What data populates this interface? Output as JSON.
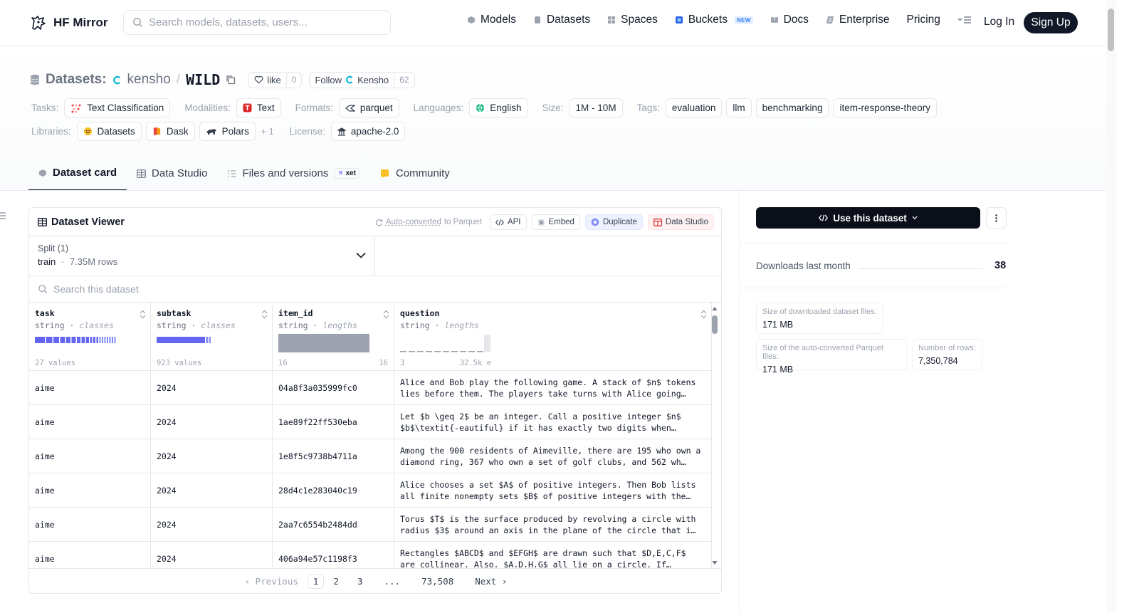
{
  "colors": {
    "brand_dark": "#111827",
    "accent_indigo": "#6366f1",
    "accent_red": "#dc2626",
    "bar_gray": "#9ca3af"
  },
  "nav": {
    "brand": "HF Mirror",
    "search_placeholder": "Search models, datasets, users...",
    "links": [
      {
        "label": "Models",
        "icon": "models-icon"
      },
      {
        "label": "Datasets",
        "icon": "datasets-icon"
      },
      {
        "label": "Spaces",
        "icon": "spaces-icon"
      },
      {
        "label": "Buckets",
        "icon": "buckets-icon",
        "badge": "NEW"
      },
      {
        "label": "Docs",
        "icon": "docs-icon"
      },
      {
        "label": "Enterprise",
        "icon": "enterprise-icon"
      },
      {
        "label": "Pricing"
      }
    ],
    "login": "Log In",
    "signup": "Sign Up"
  },
  "header": {
    "section": "Datasets:",
    "owner": "kensho",
    "slash": "/",
    "name": "WILD",
    "like_label": "like",
    "like_count": "0",
    "follow_label": "Follow",
    "follow_org": "Kensho",
    "follow_count": "62"
  },
  "tags": {
    "tasks_label": "Tasks:",
    "task": "Text Classification",
    "modalities_label": "Modalities:",
    "modality": "Text",
    "formats_label": "Formats:",
    "format": "parquet",
    "languages_label": "Languages:",
    "language": "English",
    "size_label": "Size:",
    "size": "1M - 10M",
    "tags_label": "Tags:",
    "tag_list": [
      "evaluation",
      "llm",
      "benchmarking",
      "item-response-theory"
    ],
    "libraries_label": "Libraries:",
    "libraries": [
      "Datasets",
      "Dask",
      "Polars"
    ],
    "more_libs": "+ 1",
    "license_label": "License:",
    "license": "apache-2.0"
  },
  "tabs": [
    {
      "label": "Dataset card"
    },
    {
      "label": "Data Studio"
    },
    {
      "label": "Files and versions",
      "badge": "xet"
    },
    {
      "label": "Community"
    }
  ],
  "viewer": {
    "title": "Dataset Viewer",
    "auto_converted": "Auto-converted",
    "to_parquet": "to Parquet",
    "btn_api": "API",
    "btn_embed": "Embed",
    "btn_duplicate": "Duplicate",
    "btn_datastudio": "Data Studio",
    "split_label": "Split (1)",
    "split_name": "train",
    "split_sep": "·",
    "split_rows": "7.35M rows",
    "search_placeholder": "Search this dataset",
    "columns": [
      {
        "name": "task",
        "type": "string",
        "stat": "classes",
        "caption": "27 values"
      },
      {
        "name": "subtask",
        "type": "string",
        "stat": "classes",
        "caption": "923 values"
      },
      {
        "name": "item_id",
        "type": "string",
        "stat": "lengths",
        "min": "16",
        "max": "16"
      },
      {
        "name": "question",
        "type": "string",
        "stat": "lengths",
        "min": "3",
        "max": "32.5k"
      }
    ],
    "rows": [
      {
        "task": "aime",
        "subtask": "2024",
        "item_id": "04a8f3a035999fc0",
        "question": "Alice and Bob play the following game. A stack of $n$ tokens lies before them. The players take turns with Alice going…"
      },
      {
        "task": "aime",
        "subtask": "2024",
        "item_id": "1ae89f22ff530eba",
        "question": "Let $b \\geq 2$ be an integer. Call a positive integer $n$ $b$\\textit{-eautiful} if it has exactly two digits when…"
      },
      {
        "task": "aime",
        "subtask": "2024",
        "item_id": "1e8f5c9738b4711a",
        "question": "Among the 900 residents of Aimeville, there are 195 who own a diamond ring, 367 who own a set of golf clubs, and 562 wh…"
      },
      {
        "task": "aime",
        "subtask": "2024",
        "item_id": "28d4c1e283040c19",
        "question": "Alice chooses a set $A$ of positive integers. Then Bob lists all finite nonempty sets $B$ of positive integers with the…"
      },
      {
        "task": "aime",
        "subtask": "2024",
        "item_id": "2aa7c6554b2484dd",
        "question": "Torus $T$ is the surface produced by revolving a circle with radius $3$ around an axis in the plane of the circle that i…"
      },
      {
        "task": "aime",
        "subtask": "2024",
        "item_id": "406a94e57c1198f3",
        "question": "Rectangles $ABCD$ and $EFGH$ are drawn such that $D,E,C,F$ are collinear. Also, $A,D,H,G$ all lie on a circle. If…"
      }
    ],
    "pager": {
      "prev": "Previous",
      "pages": [
        "1",
        "2",
        "3",
        "...",
        "73,508"
      ],
      "next": "Next",
      "current": "1"
    }
  },
  "sidebar": {
    "use_button": "Use this dataset",
    "downloads_label": "Downloads last month",
    "downloads_value": "38",
    "download_size_label": "Size of downloaded dataset files:",
    "download_size_value": "171 MB",
    "parquet_size_label": "Size of the auto-converted Parquet files:",
    "parquet_size_value": "171 MB",
    "rows_label": "Number of rows:",
    "rows_value": "7,350,784"
  }
}
